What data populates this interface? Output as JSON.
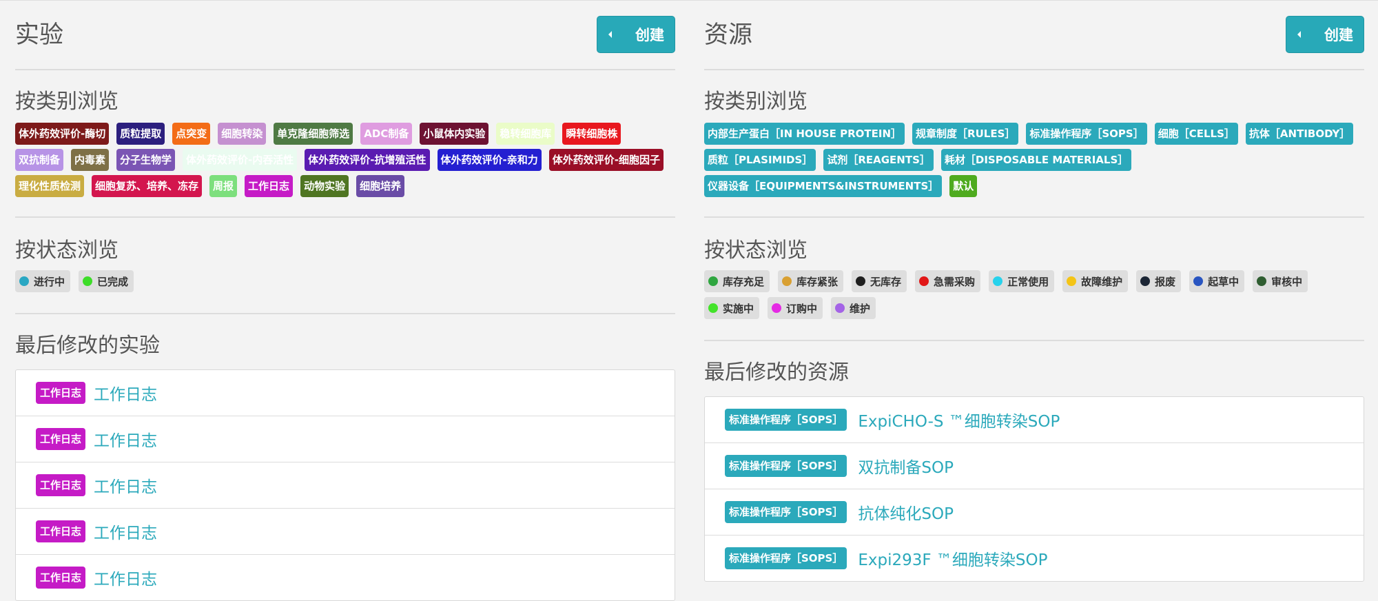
{
  "experiments": {
    "title": "实验",
    "create_label": "创建",
    "browse_category_title": "按类别浏览",
    "categories": [
      {
        "label": "体外药效评价-酶切",
        "color": "#7d1a1a"
      },
      {
        "label": "质粒提取",
        "color": "#2c1f7e"
      },
      {
        "label": "点突变",
        "color": "#f36c17"
      },
      {
        "label": "细胞转染",
        "color": "#c590d0"
      },
      {
        "label": "单克隆细胞筛选",
        "color": "#4f7a44"
      },
      {
        "label": "ADC制备",
        "color": "#df9ce0"
      },
      {
        "label": "小鼠体内实验",
        "color": "#6d1232"
      },
      {
        "label": "稳转细胞库",
        "color": "#eafcc8"
      },
      {
        "label": "瞬转细胞株",
        "color": "#e8181f"
      },
      {
        "label": "双抗制备",
        "color": "#b793e6"
      },
      {
        "label": "内毒素",
        "color": "#7e7046"
      },
      {
        "label": "分子生物学",
        "color": "#7b55b4"
      },
      {
        "label": "体外药效评价-内吞活性",
        "color": "#eafbf0"
      },
      {
        "label": "体外药效评价-抗增殖活性",
        "color": "#5a1bb1"
      },
      {
        "label": "体外药效评价-亲和力",
        "color": "#241fd1"
      },
      {
        "label": "体外药效评价-细胞因子",
        "color": "#9a0f27"
      },
      {
        "label": "理化性质检测",
        "color": "#c9ac42"
      },
      {
        "label": "细胞复苏、培养、冻存",
        "color": "#d3164e"
      },
      {
        "label": "周报",
        "color": "#7ddf7d"
      },
      {
        "label": "工作日志",
        "color": "#c51bc6"
      },
      {
        "label": "动物实验",
        "color": "#4f7522"
      },
      {
        "label": "细胞培养",
        "color": "#6a4ca6"
      }
    ],
    "browse_status_title": "按状态浏览",
    "statuses": [
      {
        "label": "进行中",
        "color": "#29a7c3"
      },
      {
        "label": "已完成",
        "color": "#3ddd28"
      }
    ],
    "recent_title": "最后修改的实验",
    "recent": [
      {
        "badge": "工作日志",
        "badge_color": "#c51bc6",
        "title": "工作日志"
      },
      {
        "badge": "工作日志",
        "badge_color": "#c51bc6",
        "title": "工作日志"
      },
      {
        "badge": "工作日志",
        "badge_color": "#c51bc6",
        "title": "工作日志"
      },
      {
        "badge": "工作日志",
        "badge_color": "#c51bc6",
        "title": "工作日志"
      },
      {
        "badge": "工作日志",
        "badge_color": "#c51bc6",
        "title": "工作日志"
      }
    ]
  },
  "resources": {
    "title": "资源",
    "create_label": "创建",
    "browse_category_title": "按类别浏览",
    "categories": [
      {
        "label": "内部生产蛋白［IN HOUSE PROTEIN］",
        "color": "#2ba9bb"
      },
      {
        "label": "规章制度［RULES］",
        "color": "#2ba9bb"
      },
      {
        "label": "标准操作程序［SOPS］",
        "color": "#2ba9bb"
      },
      {
        "label": "细胞［CELLS］",
        "color": "#2ba9bb"
      },
      {
        "label": "抗体［ANTIBODY］",
        "color": "#2ba9bb"
      },
      {
        "label": "质粒［PLASIMIDS］",
        "color": "#2ba9bb"
      },
      {
        "label": "试剂［REAGENTS］",
        "color": "#2ba9bb"
      },
      {
        "label": "耗材［DISPOSABLE MATERIALS］",
        "color": "#2ba9bb"
      },
      {
        "label": "仪器设备［EQUIPMENTS&INSTRUMENTS］",
        "color": "#2ba9bb"
      },
      {
        "label": "默认",
        "color": "#4fab1f"
      }
    ],
    "browse_status_title": "按状态浏览",
    "statuses": [
      {
        "label": "库存充足",
        "color": "#2fa640"
      },
      {
        "label": "库存紧张",
        "color": "#d9a032"
      },
      {
        "label": "无库存",
        "color": "#1e1e1e"
      },
      {
        "label": "急需采购",
        "color": "#e11616"
      },
      {
        "label": "正常使用",
        "color": "#27d2ec"
      },
      {
        "label": "故障维护",
        "color": "#f4c416"
      },
      {
        "label": "报废",
        "color": "#1c2635"
      },
      {
        "label": "起草中",
        "color": "#2955c1"
      },
      {
        "label": "审核中",
        "color": "#2f5d31"
      },
      {
        "label": "实施中",
        "color": "#43e32a"
      },
      {
        "label": "订购中",
        "color": "#e52ae4"
      },
      {
        "label": "维护",
        "color": "#a463e6"
      }
    ],
    "recent_title": "最后修改的资源",
    "recent": [
      {
        "badge": "标准操作程序［SOPS］",
        "badge_color": "#2ba9bb",
        "title": "ExpiCHO-S ™细胞转染SOP"
      },
      {
        "badge": "标准操作程序［SOPS］",
        "badge_color": "#2ba9bb",
        "title": "双抗制备SOP"
      },
      {
        "badge": "标准操作程序［SOPS］",
        "badge_color": "#2ba9bb",
        "title": "抗体纯化SOP"
      },
      {
        "badge": "标准操作程序［SOPS］",
        "badge_color": "#2ba9bb",
        "title": "Expi293F ™细胞转染SOP"
      }
    ]
  }
}
